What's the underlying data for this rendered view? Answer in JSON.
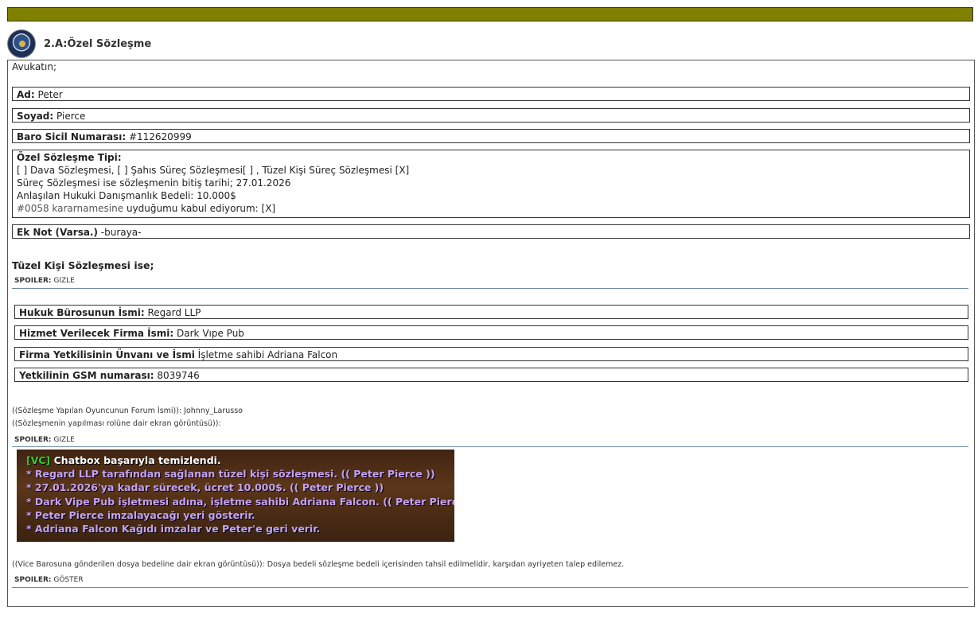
{
  "header": {
    "title": "2.A:Özel Sözleşme"
  },
  "intro": "Avukatın;",
  "fields": [
    {
      "label": "Ad:",
      "value": "Peter"
    },
    {
      "label": "Soyad:",
      "value": "Pierce"
    },
    {
      "label": "Baro Sicil Numarası:",
      "value": "#112620999"
    }
  ],
  "contract": {
    "label": "Özel Sözleşme Tipi:",
    "line1": "[ ] Dava Sözleşmesi, [ ] Şahıs Süreç Sözleşmesi[ ] , Tüzel Kişi Süreç Sözleşmesi [X]",
    "line2": "Süreç Sözleşmesi ise sözleşmenin bitiş tarihi; 27.01.2026",
    "line3": "Anlaşılan Hukuki Danışmanlık Bedeli: 10.000$",
    "line4_ref": "#0058 kararnamesine",
    "line4_rest": " uyduğumu kabul ediyorum: [X]"
  },
  "note": {
    "label": "Ek Not (Varsa.)",
    "value": " -buraya-"
  },
  "corporate_heading": "Tüzel Kişi Sözleşmesi ise;",
  "spoiler1": {
    "label": "SPOILER:",
    "action": "GIZLE"
  },
  "corporate_fields": [
    {
      "label": "Hukuk Bürosunun İsmi:",
      "value": "Regard LLP"
    },
    {
      "label": "Hizmet Verilecek Firma İsmi:",
      "value": "Dark Vıpe Pub"
    },
    {
      "label": "Firma Yetkilisinin Ünvanı ve İsmi",
      "value": "İşletme sahibi Adriana Falcon"
    },
    {
      "label": "Yetkilinin GSM numarası:",
      "value": "8039746"
    }
  ],
  "forum_name": "((Sözleşme Yapılan Oyuncunun Forum İsmi)): Johnny_Larusso",
  "screenshot_caption": "((Sözleşmenin yapılması rolüne dair ekran görüntüsü)):",
  "spoiler2": {
    "label": "SPOILER:",
    "action": "GIZLE"
  },
  "chat": {
    "lines": [
      {
        "prefix": "[VC]",
        "text": " Chatbox başarıyla temizlendi."
      },
      {
        "prefix": "",
        "text": "* Regard LLP tarafından sağlanan tüzel kişi sözleşmesi. (( Peter Pierce ))"
      },
      {
        "prefix": "",
        "text": "* 27.01.2026'ya kadar sürecek, ücret 10.000$. (( Peter Pierce ))"
      },
      {
        "prefix": "",
        "text": "* Dark Vipe Pub işletmesi adına, işletme sahibi Adriana Falcon. (( Peter Pierce ))"
      },
      {
        "prefix": "",
        "text": "* Peter Pierce imzalayacağı yeri gösterir."
      },
      {
        "prefix": "",
        "text": "* Adriana Falcon Kağıdı imzalar ve Peter'e geri verir."
      }
    ],
    "colors": {
      "vc": "#33cc33",
      "white": "#ffffff",
      "action": "#c4a2f5"
    }
  },
  "fee_note": "((Vice Barosuna gönderilen dosya bedeline dair ekran görüntüsü)): Dosya bedeli sözleşme bedeli içerisinden tahsil edilmelidir, karşıdan ayriyeten talep edilemez.",
  "spoiler3": {
    "label": "SPOILER:",
    "action": "GÖSTER"
  },
  "colors": {
    "topbar": "#7f7f00",
    "spoiler_line": "#6e89a8"
  }
}
